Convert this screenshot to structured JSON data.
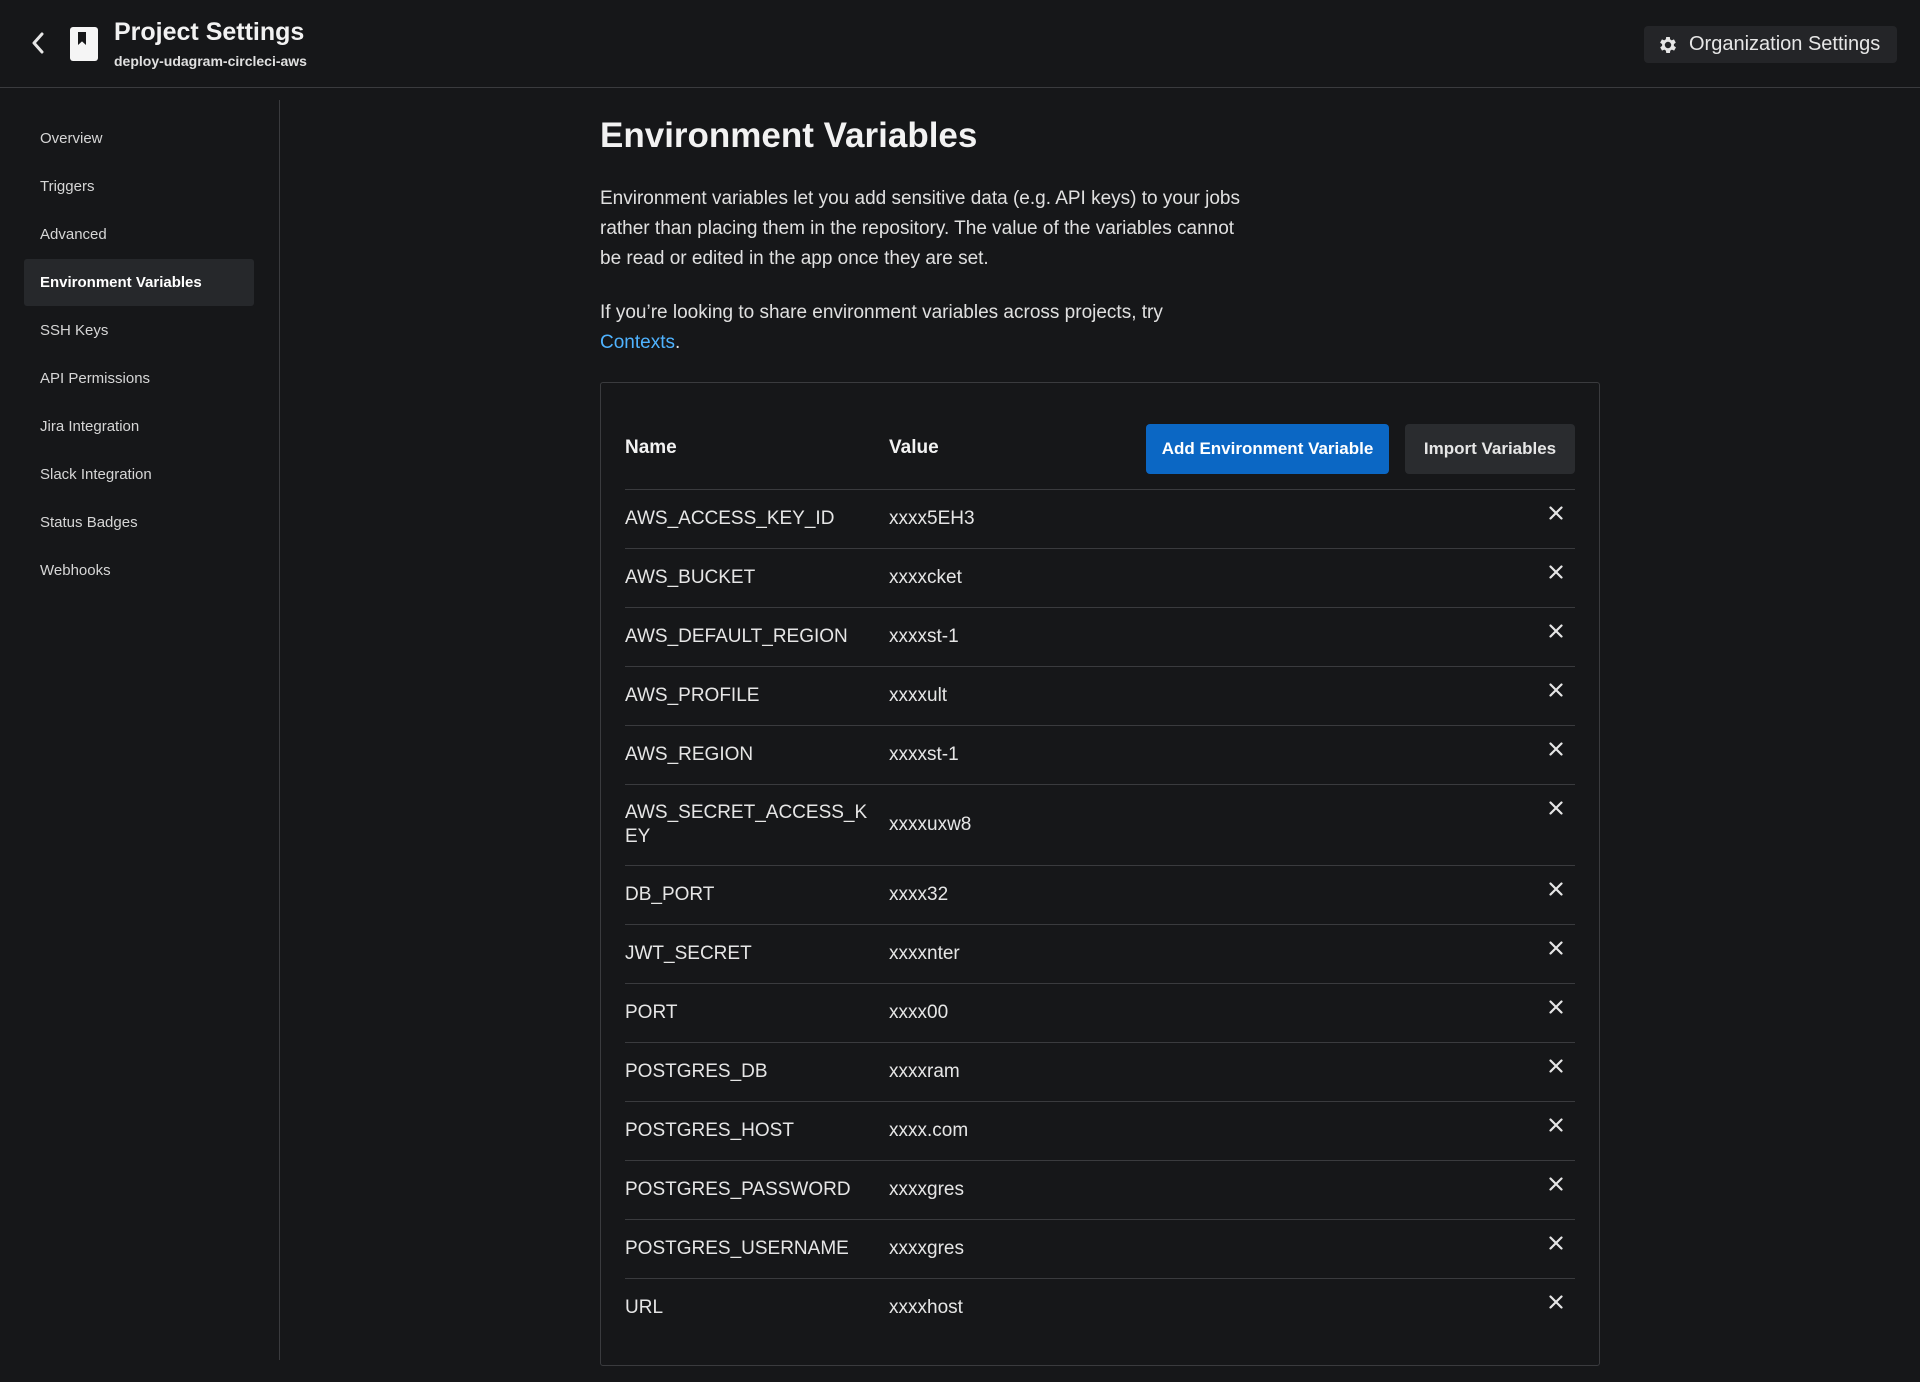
{
  "header": {
    "title": "Project Settings",
    "project_name": "deploy-udagram-circleci-aws",
    "org_settings_label": "Organization Settings"
  },
  "sidebar": {
    "items": [
      {
        "label": "Overview"
      },
      {
        "label": "Triggers"
      },
      {
        "label": "Advanced"
      },
      {
        "label": "Environment Variables",
        "active": true
      },
      {
        "label": "SSH Keys"
      },
      {
        "label": "API Permissions"
      },
      {
        "label": "Jira Integration"
      },
      {
        "label": "Slack Integration"
      },
      {
        "label": "Status Badges"
      },
      {
        "label": "Webhooks"
      }
    ]
  },
  "main": {
    "title": "Environment Variables",
    "description": "Environment variables let you add sensitive data (e.g. API keys) to your jobs rather than placing them in the repository. The value of the variables cannot be read or edited in the app once they are set.",
    "contexts_prefix": "If you’re looking to share environment variables across projects, try ",
    "contexts_link": "Contexts",
    "contexts_suffix": "."
  },
  "table": {
    "col_name": "Name",
    "col_value": "Value",
    "add_button": "Add Environment Variable",
    "import_button": "Import Variables",
    "rows": [
      {
        "name": "AWS_ACCESS_KEY_ID",
        "value": "xxxx5EH3"
      },
      {
        "name": "AWS_BUCKET",
        "value": "xxxxcket"
      },
      {
        "name": "AWS_DEFAULT_REGION",
        "value": "xxxxst-1"
      },
      {
        "name": "AWS_PROFILE",
        "value": "xxxxult"
      },
      {
        "name": "AWS_REGION",
        "value": "xxxxst-1"
      },
      {
        "name": "AWS_SECRET_ACCESS_KEY",
        "value": "xxxxuxw8"
      },
      {
        "name": "DB_PORT",
        "value": "xxxx32"
      },
      {
        "name": "JWT_SECRET",
        "value": "xxxxnter"
      },
      {
        "name": "PORT",
        "value": "xxxx00"
      },
      {
        "name": "POSTGRES_DB",
        "value": "xxxxram"
      },
      {
        "name": "POSTGRES_HOST",
        "value": "xxxx.com"
      },
      {
        "name": "POSTGRES_PASSWORD",
        "value": "xxxxgres"
      },
      {
        "name": "POSTGRES_USERNAME",
        "value": "xxxxgres"
      },
      {
        "name": "URL",
        "value": "xxxxhost"
      }
    ]
  },
  "icons": {
    "back": "chevron-left-icon",
    "project": "bookmark-icon",
    "org": "gear-icon",
    "delete": "close-icon"
  }
}
